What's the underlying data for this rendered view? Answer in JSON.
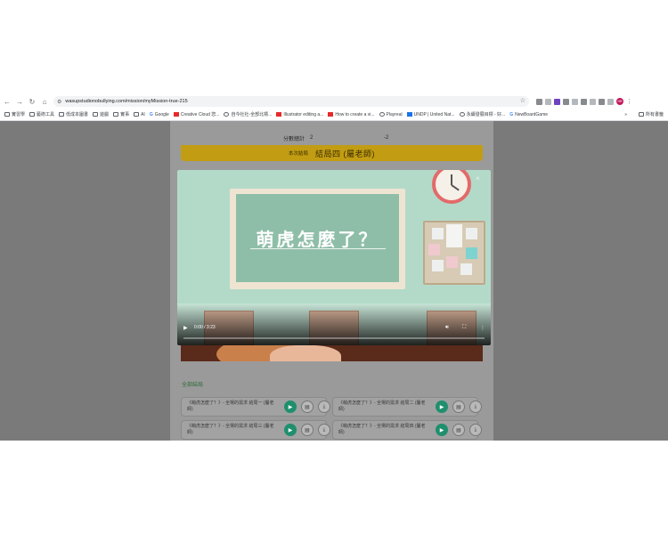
{
  "browser": {
    "url": "wasupstudionobullying.com/mission/myMission-true-215",
    "nav": [
      "←",
      "→",
      "↻",
      "⌂"
    ],
    "bookmarks": [
      {
        "label": "實習學",
        "icon": "folder"
      },
      {
        "label": "藝術工具",
        "icon": "folder"
      },
      {
        "label": "低成本圖書",
        "icon": "folder"
      },
      {
        "label": "遊戲",
        "icon": "folder"
      },
      {
        "label": "實事",
        "icon": "folder"
      },
      {
        "label": "AI",
        "icon": "folder"
      },
      {
        "label": "Google",
        "icon": "google"
      },
      {
        "label": "Creative Cloud 您...",
        "icon": "adobe"
      },
      {
        "label": "自今社社-全部北標...",
        "icon": "circle"
      },
      {
        "label": "Illustrator editing a...",
        "icon": "adobe"
      },
      {
        "label": "How to create a vi...",
        "icon": "adobe"
      },
      {
        "label": "Playreal",
        "icon": "circle"
      },
      {
        "label": "UNDP | United Nat...",
        "icon": "un"
      },
      {
        "label": "永續發展目標 - 好...",
        "icon": "circle"
      },
      {
        "label": "NewBoardGame",
        "icon": "google"
      }
    ],
    "bookmarks_more": "»",
    "all_bookmarks": "所有書籤",
    "avatar_initials": "HR"
  },
  "page": {
    "score_label": "分數總計",
    "score_value_1": "2",
    "score_value_2": "-2",
    "ending_label": "本次結局",
    "ending_value": "結局四 (屬老師)",
    "all_endings_label": "全部結局",
    "endings": [
      {
        "text": "《萌虎怎麼了？》- 全場的需求 結局一 (屬老師)"
      },
      {
        "text": "《萌虎怎麼了？》- 全場的需求 結局二 (屬老師)"
      },
      {
        "text": "《萌虎怎麼了？》- 全場的需求 結局三 (屬老師)"
      },
      {
        "text": "《萌虎怎麼了？》- 全場的需求 結局四 (屬老師)"
      }
    ]
  },
  "video": {
    "title_on_board": "萌虎怎麼了？",
    "time": "0:00 / 3:23",
    "progress": 0.0,
    "close": "×"
  }
}
